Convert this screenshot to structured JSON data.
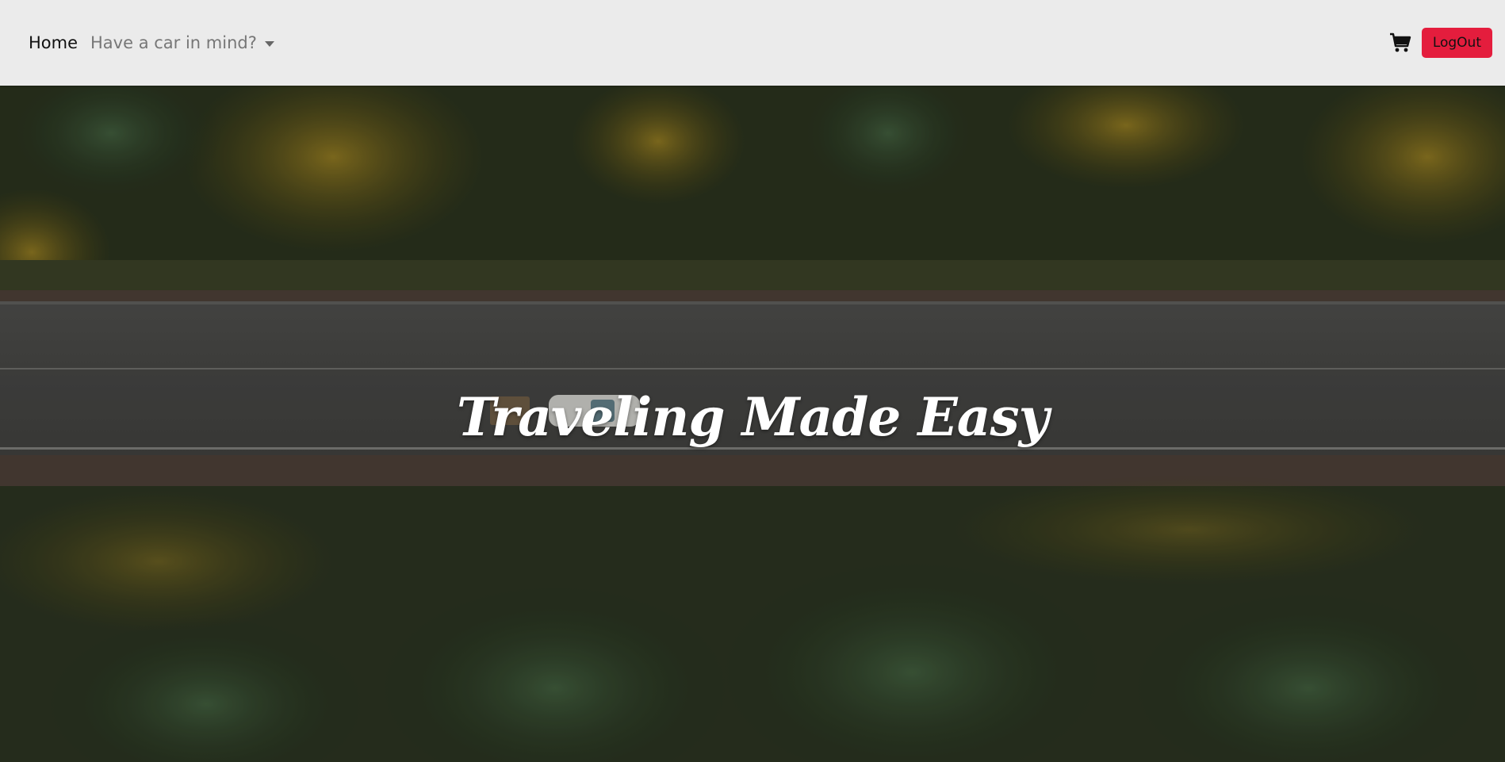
{
  "navbar": {
    "home_label": "Home",
    "dropdown_label": "Have a car in mind?",
    "cart_icon": "shopping-cart-icon",
    "logout_label": "LogOut",
    "logout_color": "#e41d3d"
  },
  "hero": {
    "title": "Traveling Made Easy"
  }
}
